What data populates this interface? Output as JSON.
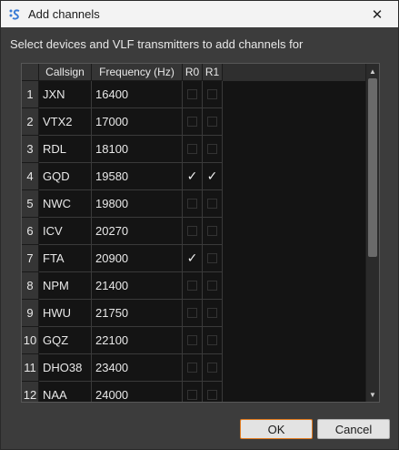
{
  "window": {
    "title": "Add channels",
    "close_glyph": "✕"
  },
  "subtitle": "Select devices and VLF transmitters to add channels for",
  "table": {
    "headers": {
      "callsign": "Callsign",
      "frequency": "Frequency (Hz)",
      "r0": "R0",
      "r1": "R1"
    },
    "rows": [
      {
        "num": "1",
        "callsign": "JXN",
        "frequency": "16400",
        "r0": false,
        "r1": false
      },
      {
        "num": "2",
        "callsign": "VTX2",
        "frequency": "17000",
        "r0": false,
        "r1": false
      },
      {
        "num": "3",
        "callsign": "RDL",
        "frequency": "18100",
        "r0": false,
        "r1": false
      },
      {
        "num": "4",
        "callsign": "GQD",
        "frequency": "19580",
        "r0": true,
        "r1": true
      },
      {
        "num": "5",
        "callsign": "NWC",
        "frequency": "19800",
        "r0": false,
        "r1": false
      },
      {
        "num": "6",
        "callsign": "ICV",
        "frequency": "20270",
        "r0": false,
        "r1": false
      },
      {
        "num": "7",
        "callsign": "FTA",
        "frequency": "20900",
        "r0": true,
        "r1": false
      },
      {
        "num": "8",
        "callsign": "NPM",
        "frequency": "21400",
        "r0": false,
        "r1": false
      },
      {
        "num": "9",
        "callsign": "HWU",
        "frequency": "21750",
        "r0": false,
        "r1": false
      },
      {
        "num": "10",
        "callsign": "GQZ",
        "frequency": "22100",
        "r0": false,
        "r1": false
      },
      {
        "num": "11",
        "callsign": "DHO38",
        "frequency": "23400",
        "r0": false,
        "r1": false
      },
      {
        "num": "12",
        "callsign": "NAA",
        "frequency": "24000",
        "r0": false,
        "r1": false
      }
    ]
  },
  "buttons": {
    "ok": "OK",
    "cancel": "Cancel"
  },
  "icons": {
    "app": "app-s-icon",
    "check_glyph": "✓",
    "scroll_up_glyph": "▲",
    "scroll_down_glyph": "▼"
  },
  "colors": {
    "accent": "#e07a1f",
    "table_bg": "#141414",
    "dialog_bg": "#3c3c3c"
  }
}
